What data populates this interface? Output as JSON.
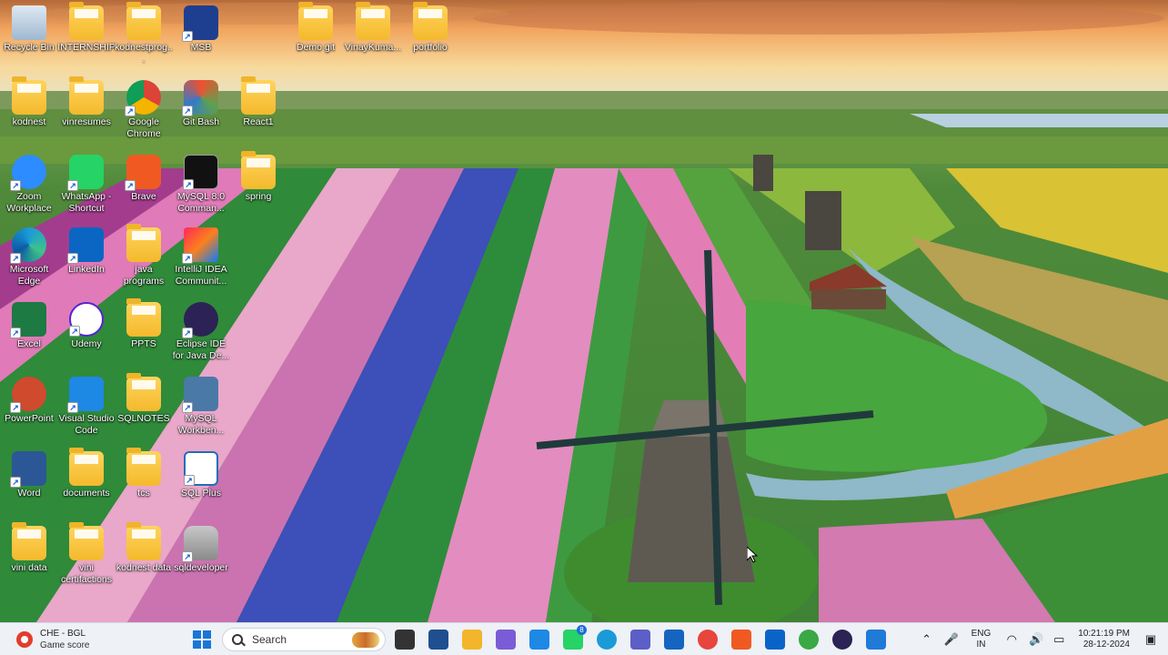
{
  "desktop": {
    "icons": [
      {
        "label": "Recycle Bin",
        "icon": "recycle-bin-icon"
      },
      {
        "label": "INTERNSHIP",
        "icon": "folder-icon"
      },
      {
        "label": "kodnestprog...",
        "icon": "folder-icon"
      },
      {
        "label": "MSB",
        "icon": "msb-app-icon"
      },
      {
        "label": "Demo git",
        "icon": "folder-icon"
      },
      {
        "label": "VinayKuma...",
        "icon": "folder-icon"
      },
      {
        "label": "portfolio",
        "icon": "folder-icon"
      },
      {
        "label": "kodnest",
        "icon": "folder-icon"
      },
      {
        "label": "vinresumes",
        "icon": "folder-icon"
      },
      {
        "label": "Google Chrome",
        "icon": "chrome-icon"
      },
      {
        "label": "Git Bash",
        "icon": "git-bash-icon"
      },
      {
        "label": "React1",
        "icon": "folder-icon"
      },
      {
        "label": "Zoom Workplace",
        "icon": "zoom-icon"
      },
      {
        "label": "WhatsApp - Shortcut",
        "icon": "whatsapp-icon"
      },
      {
        "label": "Brave",
        "icon": "brave-icon"
      },
      {
        "label": "MySQL 8.0 Comman...",
        "icon": "mysql-cmd-icon"
      },
      {
        "label": "spring",
        "icon": "folder-icon"
      },
      {
        "label": "Microsoft Edge",
        "icon": "edge-icon"
      },
      {
        "label": "LinkedIn",
        "icon": "linkedin-icon"
      },
      {
        "label": "java programs",
        "icon": "folder-icon"
      },
      {
        "label": "IntelliJ IDEA Communit...",
        "icon": "intellij-icon"
      },
      {
        "label": "Excel",
        "icon": "excel-icon"
      },
      {
        "label": "Udemy",
        "icon": "udemy-icon"
      },
      {
        "label": "PPTS",
        "icon": "folder-icon"
      },
      {
        "label": "Eclipse IDE for Java De...",
        "icon": "eclipse-icon"
      },
      {
        "label": "PowerPoint",
        "icon": "powerpoint-icon"
      },
      {
        "label": "Visual Studio Code",
        "icon": "vscode-icon"
      },
      {
        "label": "SQLNOTES",
        "icon": "folder-icon"
      },
      {
        "label": "MySQL Workben...",
        "icon": "mysql-workbench-icon"
      },
      {
        "label": "Word",
        "icon": "word-icon"
      },
      {
        "label": "documents",
        "icon": "folder-icon"
      },
      {
        "label": "tcs",
        "icon": "folder-icon"
      },
      {
        "label": "SQL Plus",
        "icon": "sqlplus-icon"
      },
      {
        "label": "vini data",
        "icon": "folder-icon"
      },
      {
        "label": "vini certifactions",
        "icon": "folder-icon"
      },
      {
        "label": "kodnest data",
        "icon": "folder-icon"
      },
      {
        "label": "sqldeveloper",
        "icon": "sqldeveloper-icon"
      }
    ]
  },
  "taskbar": {
    "widget": {
      "title": "CHE - BGL",
      "subtitle": "Game score"
    },
    "search": {
      "placeholder": "Search"
    },
    "apps": [
      {
        "name": "file-explorer-dark-icon",
        "color": "#333333"
      },
      {
        "name": "blue-app-icon",
        "color": "#1f4f8f"
      },
      {
        "name": "file-explorer-icon",
        "color": "#f2b52b"
      },
      {
        "name": "copilot-icon",
        "color": "#7a5cd6"
      },
      {
        "name": "vscode-icon",
        "color": "#1e88e5"
      },
      {
        "name": "whatsapp-icon",
        "color": "#25d366",
        "badge": "8"
      },
      {
        "name": "edge-icon",
        "color": "#1a9bd7"
      },
      {
        "name": "teams-icon",
        "color": "#5b5fc7"
      },
      {
        "name": "store-icon",
        "color": "#1565c0"
      },
      {
        "name": "chrome-icon",
        "color": "#e8453c"
      },
      {
        "name": "brave-icon",
        "color": "#f05a22"
      },
      {
        "name": "outlook-icon",
        "color": "#0a64c8"
      },
      {
        "name": "green-app-icon",
        "color": "#3aa845"
      },
      {
        "name": "eclipse-icon",
        "color": "#2c2255"
      },
      {
        "name": "snipping-tool-icon",
        "color": "#1f7ad8"
      }
    ],
    "tray": {
      "lang_top": "ENG",
      "lang_bottom": "IN",
      "time": "10:21:19 PM",
      "date": "28-12-2024"
    }
  }
}
